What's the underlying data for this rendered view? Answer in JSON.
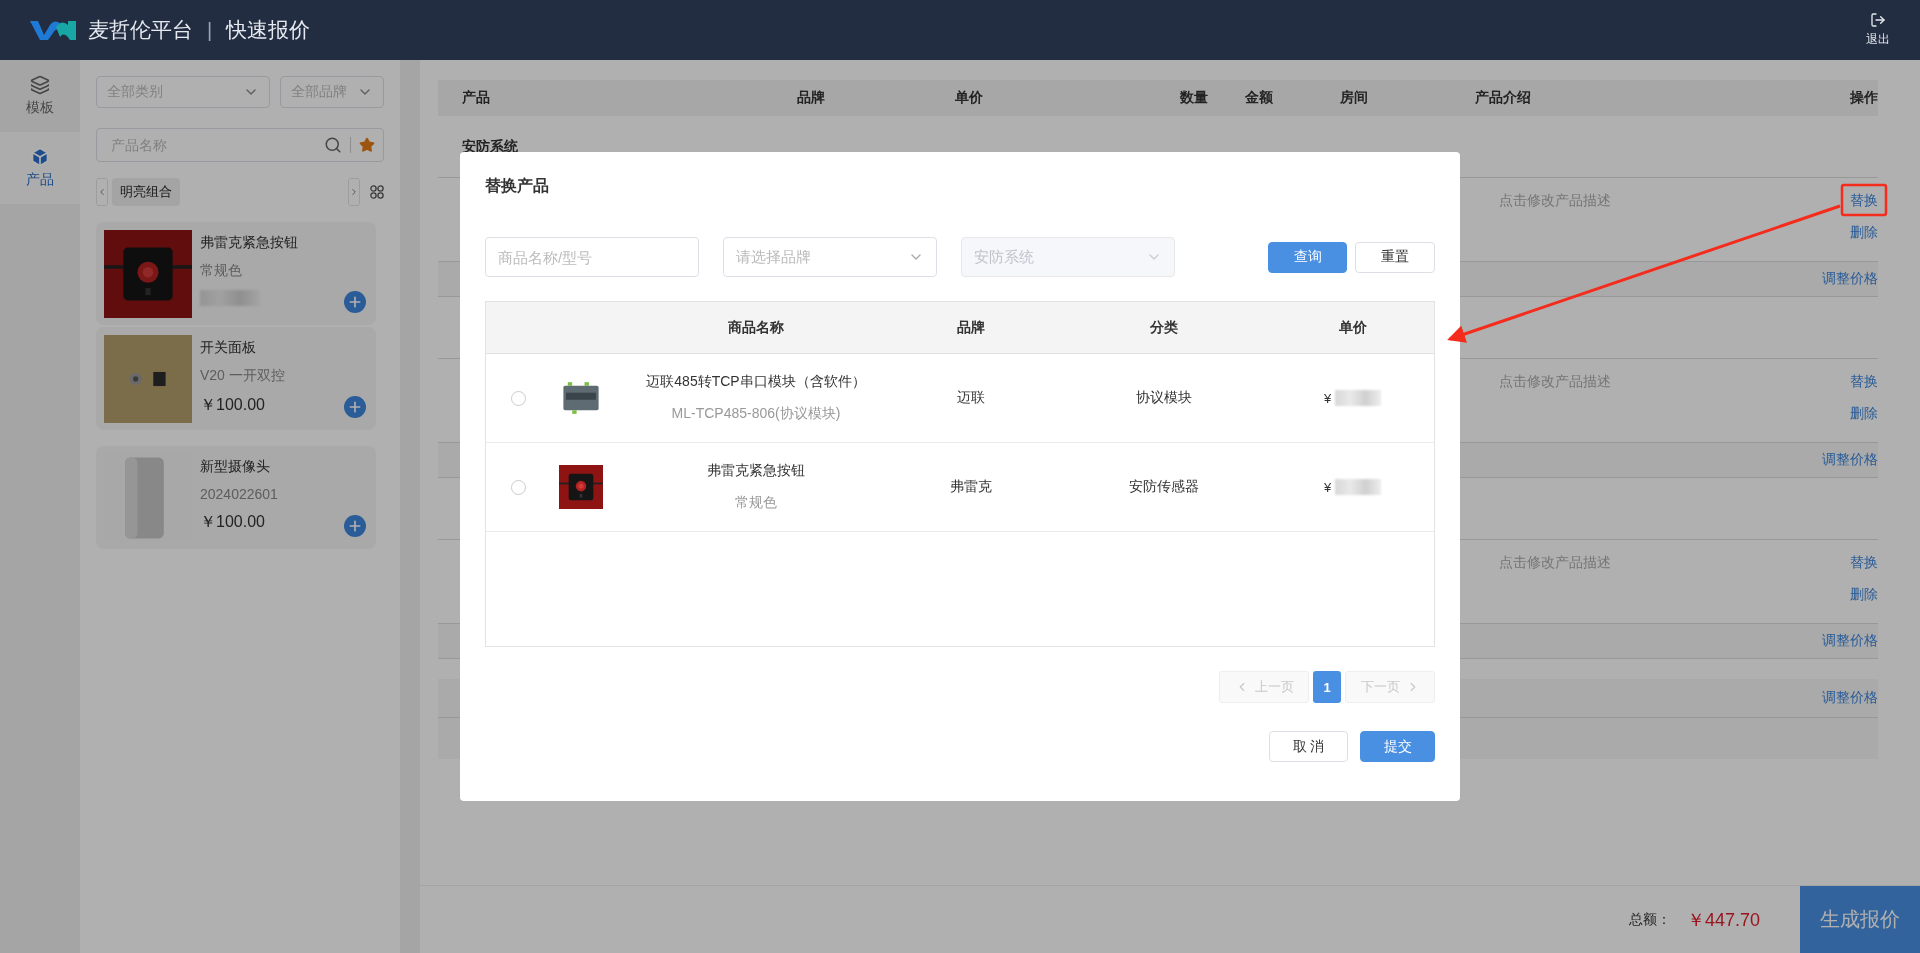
{
  "header": {
    "brand": "麦哲伦平台",
    "separator": "|",
    "page_title": "快速报价",
    "logout": "退出"
  },
  "nav": [
    {
      "label": "模板",
      "kind": "layers",
      "selected": false
    },
    {
      "label": "产品",
      "kind": "cube",
      "selected": true
    }
  ],
  "catalog": {
    "category_select": "全部类别",
    "brand_select": "全部品牌",
    "search": {
      "placeholder": "产品名称"
    },
    "chips": [
      {
        "label": "明亮组合",
        "selected": true
      }
    ],
    "products": [
      {
        "name": "弗雷克紧急按钮",
        "spec": "常规色",
        "price_redacted": true
      },
      {
        "name": "开关面板",
        "spec": "V20 一开双控",
        "price": "￥100.00"
      },
      {
        "name": "新型摄像头",
        "spec": "2024022601",
        "price": "￥100.00"
      }
    ]
  },
  "quote_table": {
    "columns": [
      "产品",
      "品牌",
      "单价",
      "数量",
      "金额",
      "房间",
      "产品介绍",
      "操作"
    ],
    "groups": [
      {
        "name": "安防系统",
        "items": [
          {
            "description": "点击修改产品描述",
            "actions": [
              "替换",
              "删除"
            ]
          }
        ],
        "adjust": "调整价格"
      },
      {
        "items": [
          {
            "description": "点击修改产品描述",
            "actions": [
              "替换",
              "删除"
            ]
          }
        ],
        "adjust": "调整价格"
      },
      {
        "items": [
          {
            "description": "点击修改产品描述",
            "actions": [
              "替换",
              "删除"
            ]
          }
        ],
        "adjust": "调整价格"
      }
    ],
    "final_adjust": "调整价格"
  },
  "total": {
    "label": "总额：",
    "amount": "￥447.70"
  },
  "generate_button": "生成报价",
  "dialog": {
    "title": "替换产品",
    "name_field": {
      "placeholder": "商品名称/型号"
    },
    "brand_select": {
      "placeholder": "请选择品牌"
    },
    "category_select": {
      "value": "安防系统",
      "disabled": true
    },
    "query_button": "查询",
    "reset_button": "重置",
    "columns": [
      "商品名称",
      "品牌",
      "分类",
      "单价"
    ],
    "rows": [
      {
        "selected": false,
        "name": "迈联485转TCP串口模块（含软件）",
        "model": "ML-TCP485-806(协议模块)",
        "brand": "迈联",
        "category": "协议模块",
        "price": "¥",
        "price_redacted": true
      },
      {
        "selected": false,
        "name": "弗雷克紧急按钮",
        "model": "常规色",
        "brand": "弗雷克",
        "category": "安防传感器",
        "price": "¥",
        "price_redacted": true
      }
    ],
    "pagination": {
      "prev": "上一页",
      "next": "下一页",
      "prev_disabled": true,
      "next_disabled": true,
      "pages": [
        {
          "label": "1",
          "selected": true
        }
      ]
    },
    "cancel_button": "取 消",
    "submit_button": "提交"
  }
}
